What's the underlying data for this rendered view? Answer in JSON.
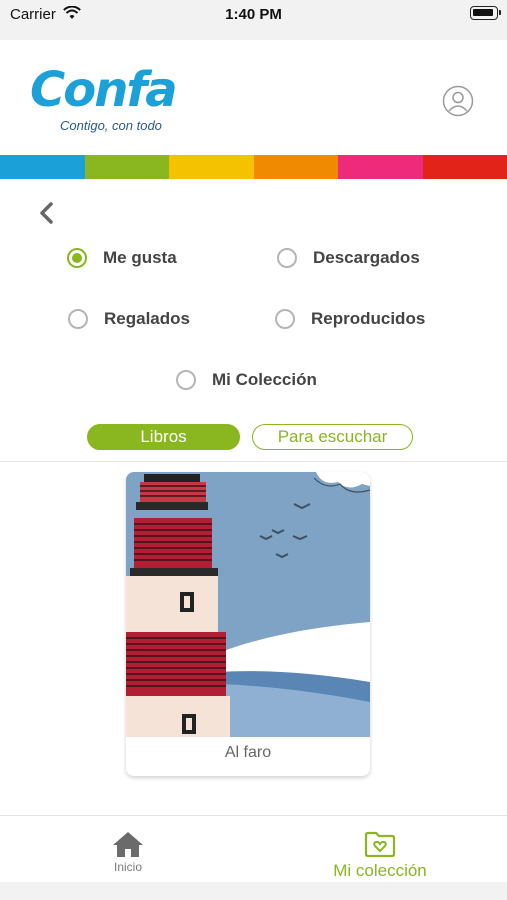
{
  "status_bar": {
    "carrier": "Carrier",
    "time": "1:40 PM"
  },
  "header": {
    "logo_text": "Confa",
    "tagline": "Contigo, con todo",
    "profile_icon": "user-circle-icon"
  },
  "color_stripe": [
    "#1ba0d8",
    "#8ab61f",
    "#f5c200",
    "#f08a00",
    "#ee2a7b",
    "#e2231a"
  ],
  "accent_color": "#8ab61f",
  "filters": {
    "options": [
      {
        "label": "Me gusta",
        "checked": true
      },
      {
        "label": "Descargados",
        "checked": false
      },
      {
        "label": "Regalados",
        "checked": false
      },
      {
        "label": "Reproducidos",
        "checked": false
      },
      {
        "label": "Mi Colección",
        "checked": false
      }
    ]
  },
  "tabs": [
    {
      "label": "Libros",
      "active": true
    },
    {
      "label": "Para escuchar",
      "active": false
    }
  ],
  "collection": [
    {
      "title": "Al faro"
    }
  ],
  "bottom_nav": {
    "home_label": "Inicio",
    "collection_label": "Mi colección"
  }
}
